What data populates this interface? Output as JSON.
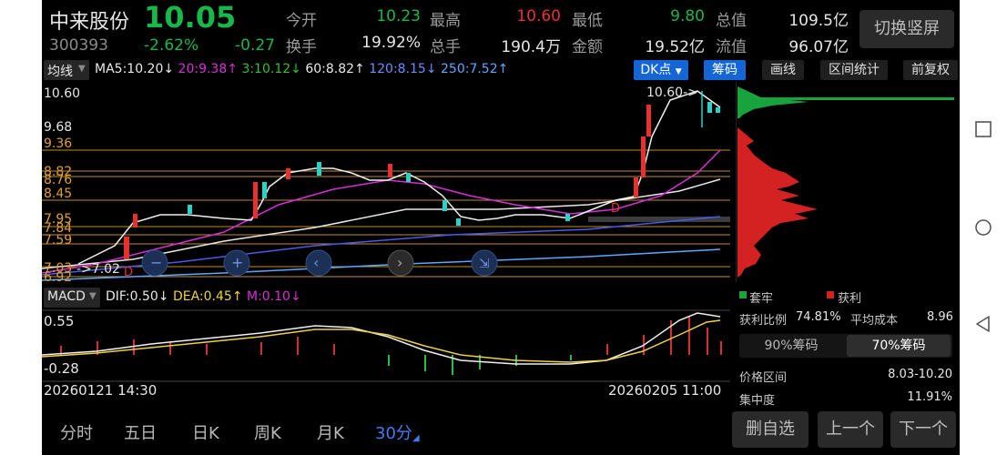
{
  "stock": {
    "name": "中来股份",
    "price": "10.05",
    "code": "300393",
    "change_pct": "-2.62%",
    "change": "-0.27"
  },
  "stats": [
    {
      "label": "今开",
      "value": "10.23",
      "color": "green"
    },
    {
      "label": "最高",
      "value": "10.60",
      "color": "red"
    },
    {
      "label": "最低",
      "value": "9.80",
      "color": "green"
    },
    {
      "label": "总值",
      "value": "109.5亿",
      "color": "white"
    },
    {
      "label": "换手",
      "value": "19.92%",
      "color": "white"
    },
    {
      "label": "总手",
      "value": "190.4万",
      "color": "white"
    },
    {
      "label": "金额",
      "value": "19.52亿",
      "color": "white"
    },
    {
      "label": "流值",
      "value": "96.07亿",
      "color": "white"
    }
  ],
  "switch_button": "切换竖屏",
  "ma": {
    "selector": "均线",
    "items": [
      {
        "text": "MA5:10.20↓",
        "color": "#e8e8e8"
      },
      {
        "text": "20:9.38↑",
        "color": "#d62fd6"
      },
      {
        "text": "3:10.12↓",
        "color": "#30c030"
      },
      {
        "text": "60:8.82↑",
        "color": "#e8e8e8"
      },
      {
        "text": "120:8.15↓",
        "color": "#6f8cff"
      },
      {
        "text": "250:7.52↑",
        "color": "#5aa8ff"
      }
    ]
  },
  "toolbar": {
    "dk": "DK点",
    "chips": "筹码",
    "draw": "画线",
    "range": "区间统计",
    "adjust": "前复权"
  },
  "price_axis": {
    "top": "10.60",
    "p968": "9.68",
    "p936": "9.36",
    "p882": "8.82",
    "p876": "8.76",
    "p845": "8.45",
    "p795": "7.95",
    "p784": "7.84",
    "p759": "7.59",
    "p703": "7.03",
    "p692": "6.92",
    "low_marker": "7.02",
    "high_marker": "10.60->",
    "d_marker": "D"
  },
  "macd": {
    "selector": "MACD",
    "dif": "DIF:0.50↓",
    "dea": "DEA:0.45↑",
    "m": "M:0.10↓",
    "axis_top": "0.55",
    "axis_bottom": "-0.28"
  },
  "time_axis": {
    "start": "20260121 14:30",
    "end": "20260205 11:00"
  },
  "period_tabs": [
    {
      "label": "分时",
      "active": false
    },
    {
      "label": "五日",
      "active": false
    },
    {
      "label": "日K",
      "active": false
    },
    {
      "label": "周K",
      "active": false
    },
    {
      "label": "月K",
      "active": false
    },
    {
      "label": "30分",
      "active": true
    }
  ],
  "chips_panel": {
    "legend_trapped": "套牢",
    "legend_profit": "获利",
    "profit_ratio_label": "获利比例",
    "profit_ratio": "74.81%",
    "avg_cost_label": "平均成本",
    "avg_cost": "8.96",
    "tab90": "90%筹码",
    "tab70": "70%筹码",
    "price_range_label": "价格区间",
    "price_range": "8.03-10.20",
    "concentration_label": "集中度",
    "concentration": "11.91%",
    "colors": {
      "trapped": "#17a43c",
      "profit": "#d42222"
    }
  },
  "actions": {
    "remove": "删自选",
    "prev": "上一个",
    "next": "下一个"
  }
}
